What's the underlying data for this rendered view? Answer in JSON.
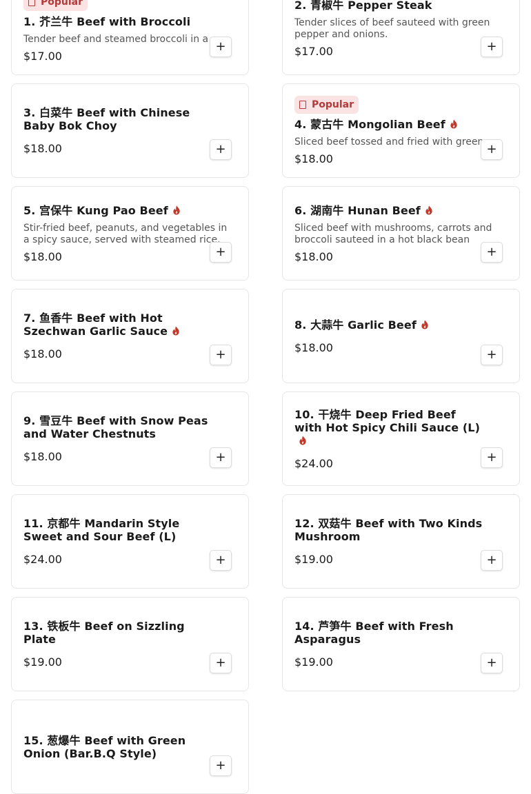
{
  "badge_label": "Popular",
  "currency": "$",
  "items": [
    {
      "number": "1.",
      "cn": "芥兰牛",
      "name": "Beef with Broccoli",
      "desc": "Tender beef and steamed broccoli in a",
      "price": "$17.00",
      "popular": true,
      "spicy": false
    },
    {
      "number": "2.",
      "cn": "青椒牛",
      "name": "Pepper Steak",
      "desc": "Tender slices of beef sauteed with green pepper and onions.",
      "price": "$17.00",
      "popular": false,
      "spicy": false
    },
    {
      "number": "3.",
      "cn": "白菜牛",
      "name": "Beef with Chinese Baby Bok Choy",
      "desc": "",
      "price": "$18.00",
      "popular": false,
      "spicy": false
    },
    {
      "number": "4.",
      "cn": "蒙古牛",
      "name": "Mongolian Beef",
      "desc": "Sliced beef tossed and fried with green on...",
      "price": "$18.00",
      "popular": true,
      "spicy": true
    },
    {
      "number": "5.",
      "cn": "宫保牛",
      "name": "Kung Pao Beef",
      "desc": "Stir-fried beef, peanuts, and vegetables in a spicy sauce, served with steamed rice.",
      "price": "$18.00",
      "popular": false,
      "spicy": true
    },
    {
      "number": "6.",
      "cn": "湖南牛",
      "name": "Hunan Beef",
      "desc": "Sliced beef with mushrooms, carrots and broccoli sauteed in a hot black bean sauce.",
      "price": "$18.00",
      "popular": false,
      "spicy": true
    },
    {
      "number": "7.",
      "cn": "鱼香牛",
      "name": "Beef with Hot Szechwan Garlic Sauce",
      "desc": "",
      "price": "$18.00",
      "popular": false,
      "spicy": true
    },
    {
      "number": "8.",
      "cn": "大蒜牛",
      "name": "Garlic Beef",
      "desc": "",
      "price": "$18.00",
      "popular": false,
      "spicy": true
    },
    {
      "number": "9.",
      "cn": "雪豆牛",
      "name": "Beef with Snow Peas and Water Chestnuts",
      "desc": "",
      "price": "$18.00",
      "popular": false,
      "spicy": false
    },
    {
      "number": "10.",
      "cn": "干烧牛",
      "name": "Deep Fried Beef with Hot Spicy Chili Sauce (L)",
      "desc": "",
      "price": "$24.00",
      "popular": false,
      "spicy": true
    },
    {
      "number": "11.",
      "cn": "京都牛",
      "name": "Mandarin Style Sweet and Sour Beef (L)",
      "desc": "",
      "price": "$24.00",
      "popular": false,
      "spicy": false
    },
    {
      "number": "12.",
      "cn": "双菇牛",
      "name": "Beef with Two Kinds Mushroom",
      "desc": "",
      "price": "$19.00",
      "popular": false,
      "spicy": false
    },
    {
      "number": "13.",
      "cn": "铁板牛",
      "name": "Beef on Sizzling Plate",
      "desc": "",
      "price": "$19.00",
      "popular": false,
      "spicy": false
    },
    {
      "number": "14.",
      "cn": "芦笋牛",
      "name": "Beef with Fresh Asparagus",
      "desc": "",
      "price": "$19.00",
      "popular": false,
      "spicy": false
    },
    {
      "number": "15.",
      "cn": "葱爆牛",
      "name": "Beef with Green Onion (Bar.B.Q Style)",
      "desc": "",
      "price": "",
      "popular": false,
      "spicy": false
    }
  ],
  "add_button_label": "+",
  "colors": {
    "badge_bg": "#fbe3e3",
    "badge_text": "#b23a3a",
    "chili": "#c0392b",
    "border": "#e6e6e6"
  }
}
